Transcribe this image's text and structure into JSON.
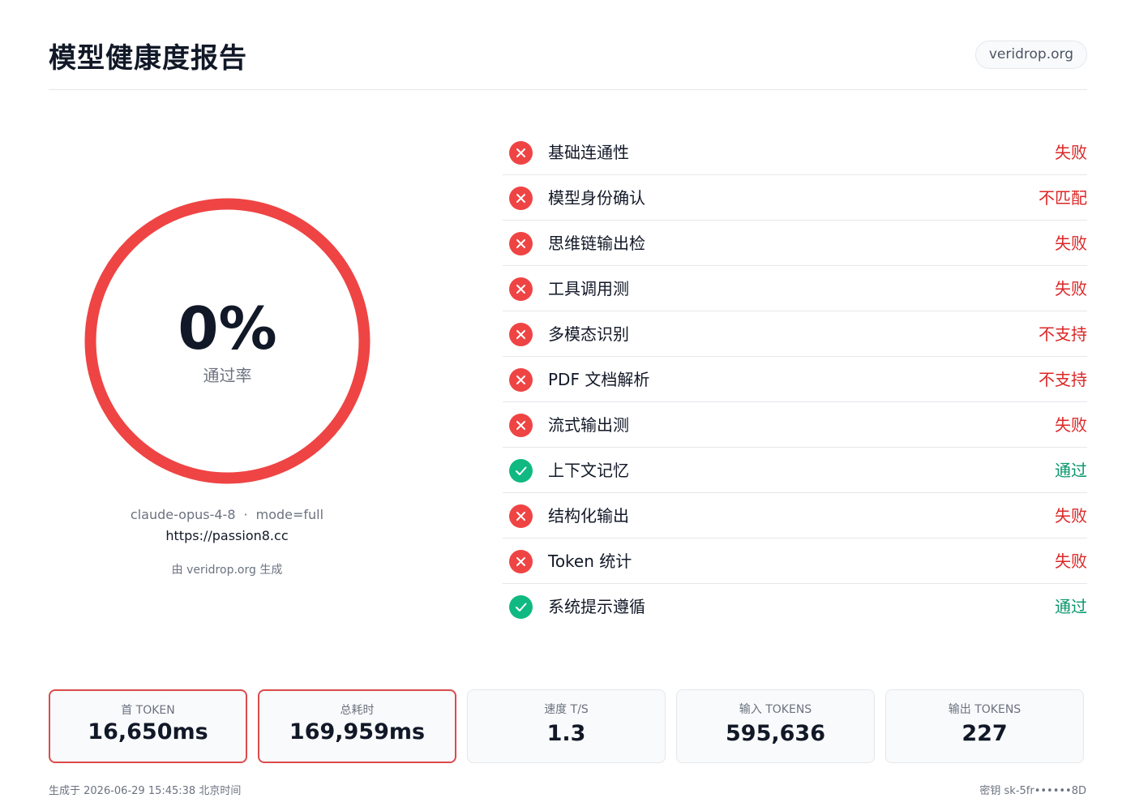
{
  "header": {
    "title": "模型健康度报告",
    "domain": "veridrop.org"
  },
  "score": {
    "percent": "0%",
    "percent_value": 0,
    "label": "通过率",
    "ring_color": "#ef4444"
  },
  "meta": {
    "model": "claude-opus-4-8",
    "separator": "·",
    "mode": "mode=full",
    "url": "https://passion8.cc",
    "powered_by": "由 veridrop.org 生成"
  },
  "checks": [
    {
      "name": "基础连通性",
      "status": "失败",
      "result": "fail"
    },
    {
      "name": "模型身份确认",
      "status": "不匹配",
      "result": "fail"
    },
    {
      "name": "思维链输出检",
      "status": "失败",
      "result": "fail"
    },
    {
      "name": "工具调用测",
      "status": "失败",
      "result": "fail"
    },
    {
      "name": "多模态识别",
      "status": "不支持",
      "result": "fail"
    },
    {
      "name": "PDF 文档解析",
      "status": "不支持",
      "result": "fail"
    },
    {
      "name": "流式输出测",
      "status": "失败",
      "result": "fail"
    },
    {
      "name": "上下文记忆",
      "status": "通过",
      "result": "pass"
    },
    {
      "name": "结构化输出",
      "status": "失败",
      "result": "fail"
    },
    {
      "name": "Token 统计",
      "status": "失败",
      "result": "fail"
    },
    {
      "name": "系统提示遵循",
      "status": "通过",
      "result": "pass"
    }
  ],
  "stats": [
    {
      "label": "首 TOKEN",
      "value": "16,650ms",
      "alert": true
    },
    {
      "label": "总耗时",
      "value": "169,959ms",
      "alert": true
    },
    {
      "label": "速度 T/S",
      "value": "1.3",
      "alert": false
    },
    {
      "label": "输入 TOKENS",
      "value": "595,636",
      "alert": false
    },
    {
      "label": "输出 TOKENS",
      "value": "227",
      "alert": false
    }
  ],
  "footer": {
    "timestamp": "生成于 2026-06-29 15:45:38 北京时间",
    "key": "密钥 sk-5fr••••••8D"
  },
  "colors": {
    "fail": "#ef4444",
    "pass": "#10b981",
    "alert_border": "#dc4b4b"
  }
}
